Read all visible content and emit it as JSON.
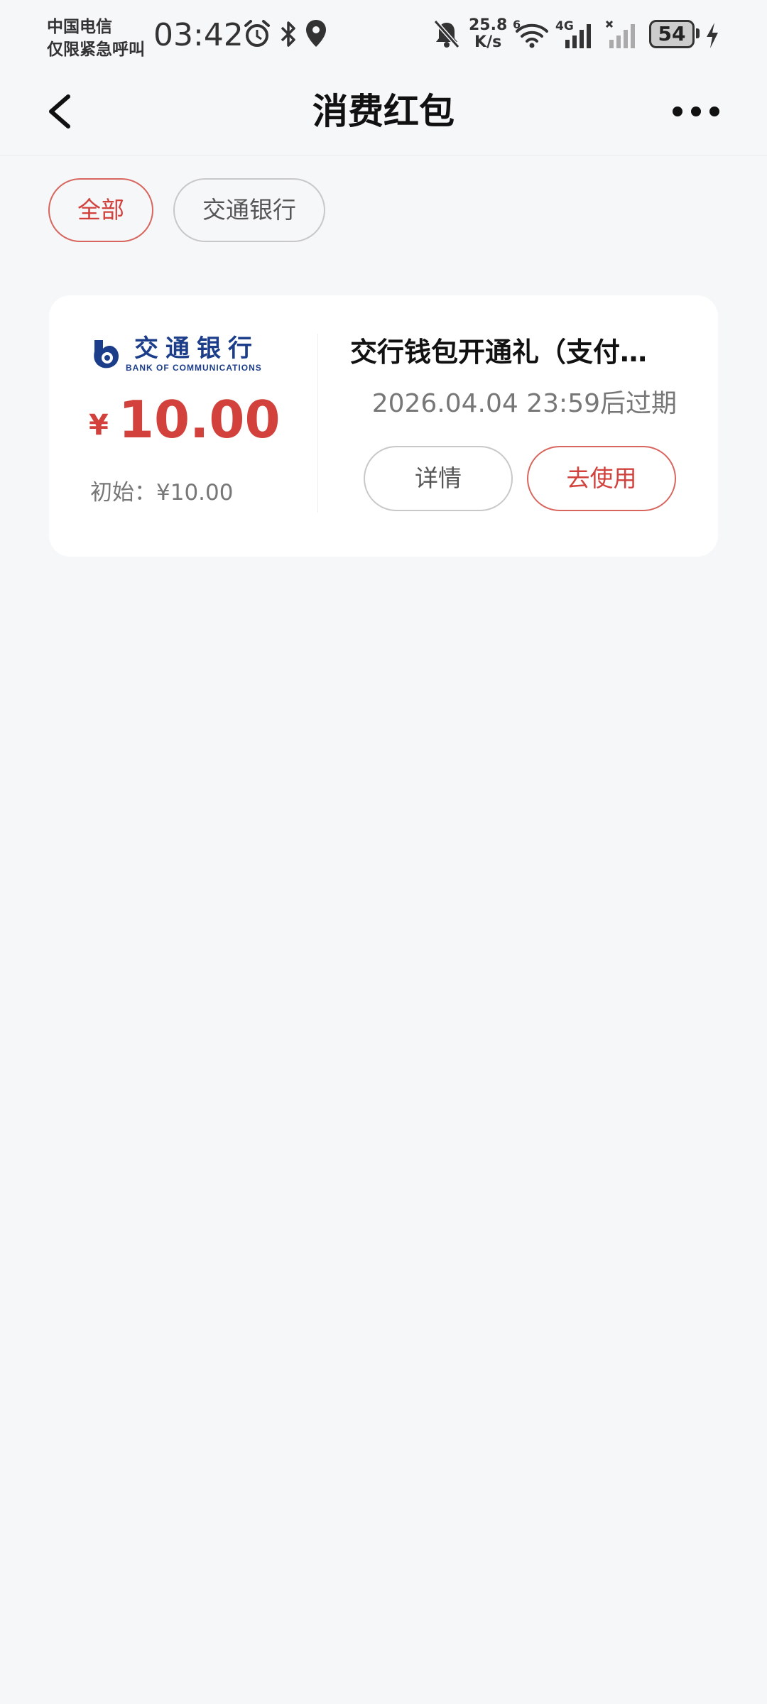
{
  "status_bar": {
    "carrier_line1": "中国电信",
    "carrier_line2": "仅限紧急呼叫",
    "time": "03:42",
    "net_speed_value": "25.8",
    "net_speed_unit": "K/s",
    "network_type": "4G",
    "wifi_badge": "6",
    "battery_level": "54",
    "icons": [
      "alarm-icon",
      "bluetooth-icon",
      "location-icon",
      "mute-icon",
      "wifi-icon",
      "signal-icon",
      "signal-no-sim-icon",
      "charging-icon"
    ]
  },
  "nav": {
    "title": "消费红包",
    "back_icon": "chevron-left-icon",
    "more_icon": "more-dots-icon"
  },
  "filters": {
    "items": [
      {
        "label": "全部",
        "active": true
      },
      {
        "label": "交通银行",
        "active": false
      }
    ]
  },
  "coupon": {
    "bank_name_cn": "交通银行",
    "bank_name_en": "BANK OF COMMUNICATIONS",
    "currency_symbol": "¥",
    "amount": "10.00",
    "initial_label": "初始：¥10.00",
    "title": "交行钱包开通礼（支付…",
    "expiry": "2026.04.04 23:59后过期",
    "detail_label": "详情",
    "use_label": "去使用"
  },
  "colors": {
    "accent_red": "#d2413b",
    "bank_blue": "#1c3e8a",
    "background": "#f6f7f9"
  }
}
